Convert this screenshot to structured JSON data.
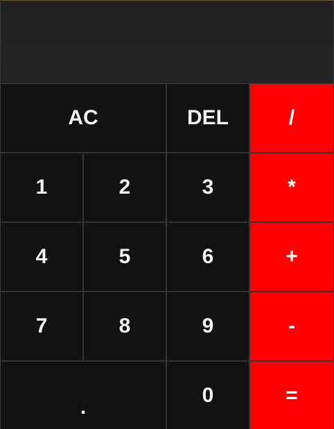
{
  "display": {
    "value": ""
  },
  "keys": {
    "clear": "AC",
    "delete": "DEL",
    "divide": "/",
    "one": "1",
    "two": "2",
    "three": "3",
    "multiply": "*",
    "four": "4",
    "five": "5",
    "six": "6",
    "add": "+",
    "seven": "7",
    "eight": "8",
    "nine": "9",
    "subtract": "-",
    "decimal": ".",
    "zero": "0",
    "equals": "="
  },
  "colors": {
    "operator_bg": "#ff0000",
    "key_bg": "#121212",
    "display_bg": "#222222",
    "grid_line": "#333333",
    "text": "#f2f2f2"
  }
}
